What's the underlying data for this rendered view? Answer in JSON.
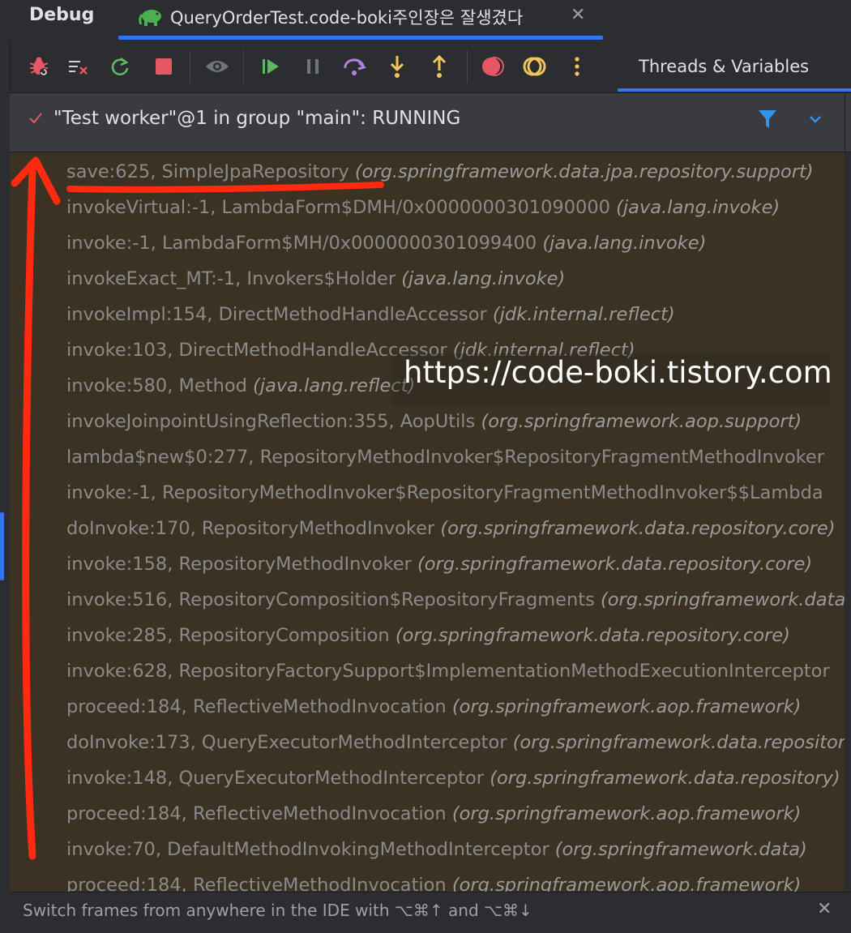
{
  "tool_window": {
    "title": "Debug"
  },
  "tab": {
    "title": "QueryOrderTest.code-boki주인장은 잘생겼다",
    "close": "✕"
  },
  "toolbar": {
    "buttons": [
      "rerun-debug-icon",
      "clear-icon",
      "rerun-icon",
      "stop-icon",
      "view-breakpoints-icon",
      "resume-icon",
      "pause-icon",
      "step-over-icon",
      "step-into-icon",
      "step-out-icon",
      "breakpoint-icon",
      "mute-breakpoints-icon",
      "more-icon"
    ],
    "right_tab_label": "Threads & Variables"
  },
  "thread": {
    "label": "\"Test worker\"@1 in group \"main\": RUNNING",
    "accent_color": "#3574f0"
  },
  "frames": [
    {
      "method": "save:625, SimpleJpaRepository ",
      "pkg": "(org.springframework.data.jpa.repository.support)"
    },
    {
      "method": "invokeVirtual:-1, LambdaForm$DMH/0x0000000301090000 ",
      "pkg": "(java.lang.invoke)"
    },
    {
      "method": "invoke:-1, LambdaForm$MH/0x0000000301099400 ",
      "pkg": "(java.lang.invoke)"
    },
    {
      "method": "invokeExact_MT:-1, Invokers$Holder ",
      "pkg": "(java.lang.invoke)"
    },
    {
      "method": "invokeImpl:154, DirectMethodHandleAccessor ",
      "pkg": "(jdk.internal.reflect)"
    },
    {
      "method": "invoke:103, DirectMethodHandleAccessor ",
      "pkg": "(jdk.internal.reflect)"
    },
    {
      "method": "invoke:580, Method ",
      "pkg": "(java.lang.reflect)"
    },
    {
      "method": "invokeJoinpointUsingReflection:355, AopUtils ",
      "pkg": "(org.springframework.aop.support)"
    },
    {
      "method": "lambda$new$0:277, RepositoryMethodInvoker$RepositoryFragmentMethodInvoker ",
      "pkg": ""
    },
    {
      "method": "invoke:-1, RepositoryMethodInvoker$RepositoryFragmentMethodInvoker$$Lambda",
      "pkg": ""
    },
    {
      "method": "doInvoke:170, RepositoryMethodInvoker ",
      "pkg": "(org.springframework.data.repository.core)"
    },
    {
      "method": "invoke:158, RepositoryMethodInvoker ",
      "pkg": "(org.springframework.data.repository.core)"
    },
    {
      "method": "invoke:516, RepositoryComposition$RepositoryFragments ",
      "pkg": "(org.springframework.data)"
    },
    {
      "method": "invoke:285, RepositoryComposition ",
      "pkg": "(org.springframework.data.repository.core)"
    },
    {
      "method": "invoke:628, RepositoryFactorySupport$ImplementationMethodExecutionInterceptor",
      "pkg": ""
    },
    {
      "method": "proceed:184, ReflectiveMethodInvocation ",
      "pkg": "(org.springframework.aop.framework)"
    },
    {
      "method": "doInvoke:173, QueryExecutorMethodInterceptor ",
      "pkg": "(org.springframework.data.repository)"
    },
    {
      "method": "invoke:148, QueryExecutorMethodInterceptor ",
      "pkg": "(org.springframework.data.repository)"
    },
    {
      "method": "proceed:184, ReflectiveMethodInvocation ",
      "pkg": "(org.springframework.aop.framework)"
    },
    {
      "method": "invoke:70, DefaultMethodInvokingMethodInterceptor ",
      "pkg": "(org.springframework.data)"
    },
    {
      "method": "proceed:184, ReflectiveMethodInvocation ",
      "pkg": "(org.springframework.aop.framework)"
    }
  ],
  "watermark": "https://code-boki.tistory.com",
  "status_hint": "Switch frames from anywhere in the IDE with ⌥⌘↑ and ⌥⌘↓",
  "status_close": "✕",
  "annotation_color": "#ff2a10"
}
